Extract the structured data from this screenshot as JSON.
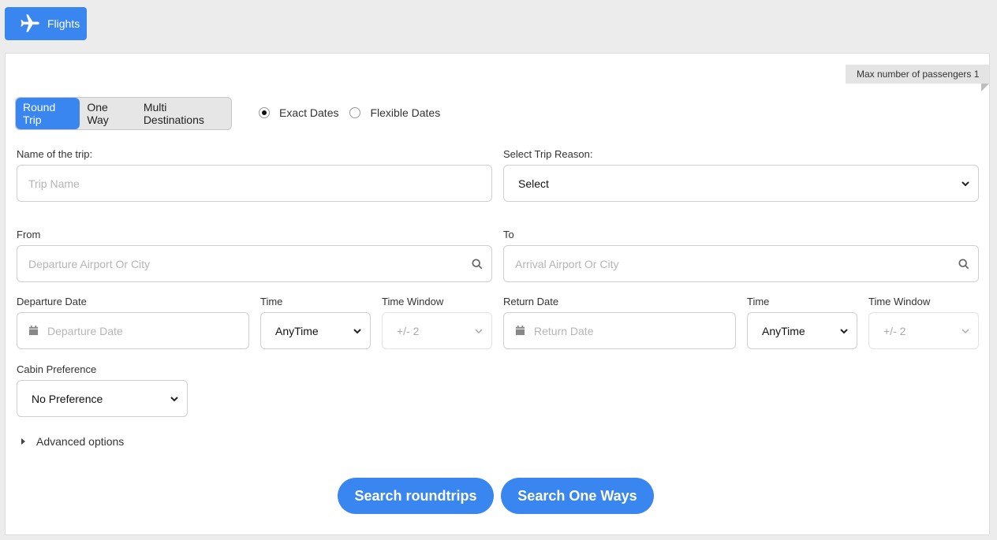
{
  "tab": {
    "label": "Flights",
    "icon": "airplane-icon"
  },
  "max_passengers": "Max number of passengers 1",
  "trip_types": [
    "Round Trip",
    "One Way",
    "Multi Destinations"
  ],
  "date_modes": [
    "Exact Dates",
    "Flexible Dates"
  ],
  "form": {
    "trip_name_label": "Name of the trip:",
    "trip_name_placeholder": "Trip Name",
    "trip_reason_label": "Select Trip Reason:",
    "trip_reason_value": "Select",
    "from_label": "From",
    "from_placeholder": "Departure Airport Or City",
    "to_label": "To",
    "to_placeholder": "Arrival Airport Or City",
    "departure_date_label": "Departure Date",
    "departure_date_placeholder": "Departure Date",
    "time_label": "Time",
    "time_value": "AnyTime",
    "time_window_label": "Time Window",
    "time_window_value": "+/- 2",
    "return_date_label": "Return Date",
    "return_date_placeholder": "Return Date",
    "cabin_label": "Cabin Preference",
    "cabin_value": "No Preference",
    "advanced_label": "Advanced options"
  },
  "buttons": {
    "search_roundtrips": "Search roundtrips",
    "search_one_ways": "Search One Ways"
  },
  "colors": {
    "accent": "#3a86f0"
  }
}
